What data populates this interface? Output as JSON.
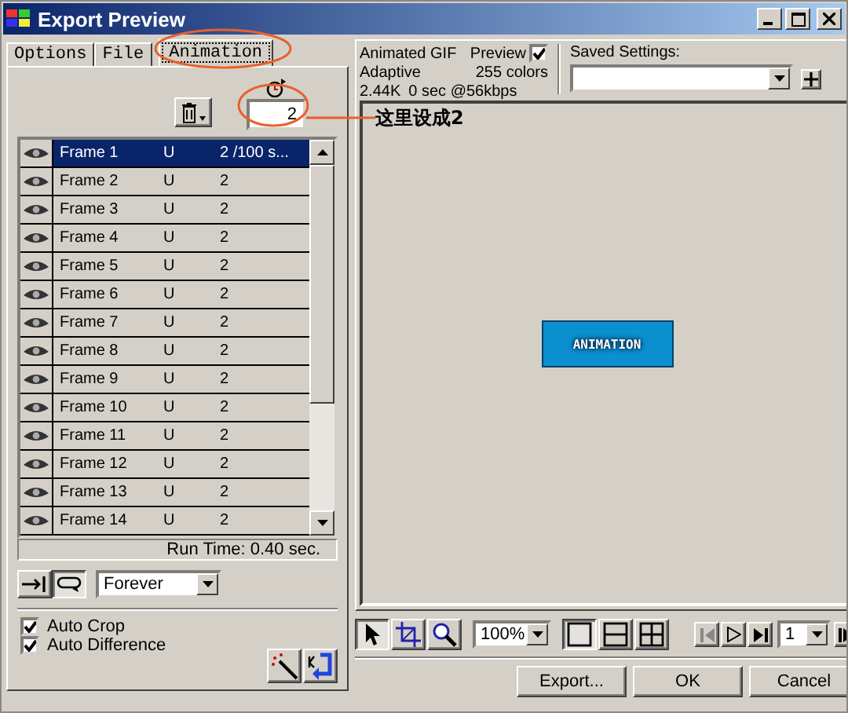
{
  "window": {
    "title": "Export Preview"
  },
  "tabs": [
    {
      "label": "Options",
      "selected": false
    },
    {
      "label": "File",
      "selected": false
    },
    {
      "label": "Animation",
      "selected": true
    }
  ],
  "frame_delay": {
    "value": "2"
  },
  "frames": [
    {
      "name": "Frame 1",
      "disposal": "U",
      "delay": "2 /100 s...",
      "selected": true
    },
    {
      "name": "Frame 2",
      "disposal": "U",
      "delay": "2",
      "selected": false
    },
    {
      "name": "Frame 3",
      "disposal": "U",
      "delay": "2",
      "selected": false
    },
    {
      "name": "Frame 4",
      "disposal": "U",
      "delay": "2",
      "selected": false
    },
    {
      "name": "Frame 5",
      "disposal": "U",
      "delay": "2",
      "selected": false
    },
    {
      "name": "Frame 6",
      "disposal": "U",
      "delay": "2",
      "selected": false
    },
    {
      "name": "Frame 7",
      "disposal": "U",
      "delay": "2",
      "selected": false
    },
    {
      "name": "Frame 8",
      "disposal": "U",
      "delay": "2",
      "selected": false
    },
    {
      "name": "Frame 9",
      "disposal": "U",
      "delay": "2",
      "selected": false
    },
    {
      "name": "Frame 10",
      "disposal": "U",
      "delay": "2",
      "selected": false
    },
    {
      "name": "Frame 11",
      "disposal": "U",
      "delay": "2",
      "selected": false
    },
    {
      "name": "Frame 12",
      "disposal": "U",
      "delay": "2",
      "selected": false
    },
    {
      "name": "Frame 13",
      "disposal": "U",
      "delay": "2",
      "selected": false
    },
    {
      "name": "Frame 14",
      "disposal": "U",
      "delay": "2",
      "selected": false
    }
  ],
  "run_time": "Run Time: 0.40 sec.",
  "loop": {
    "value": "Forever"
  },
  "checkboxes": [
    {
      "label": "Auto Crop",
      "checked": true
    },
    {
      "label": "Auto Difference",
      "checked": true
    }
  ],
  "info": {
    "format": "Animated GIF",
    "palette": "Adaptive",
    "colors": "255 colors",
    "size": "2.44K",
    "time": "0 sec @56kbps",
    "preview": {
      "label": "Preview",
      "checked": true
    }
  },
  "saved_settings": {
    "label": "Saved Settings:"
  },
  "preview_banner": "ANIMATION",
  "annotation": "这里设成2",
  "toolbar": {
    "zoom": "100%",
    "frame": "1"
  },
  "buttons": [
    "Export...",
    "OK",
    "Cancel"
  ]
}
